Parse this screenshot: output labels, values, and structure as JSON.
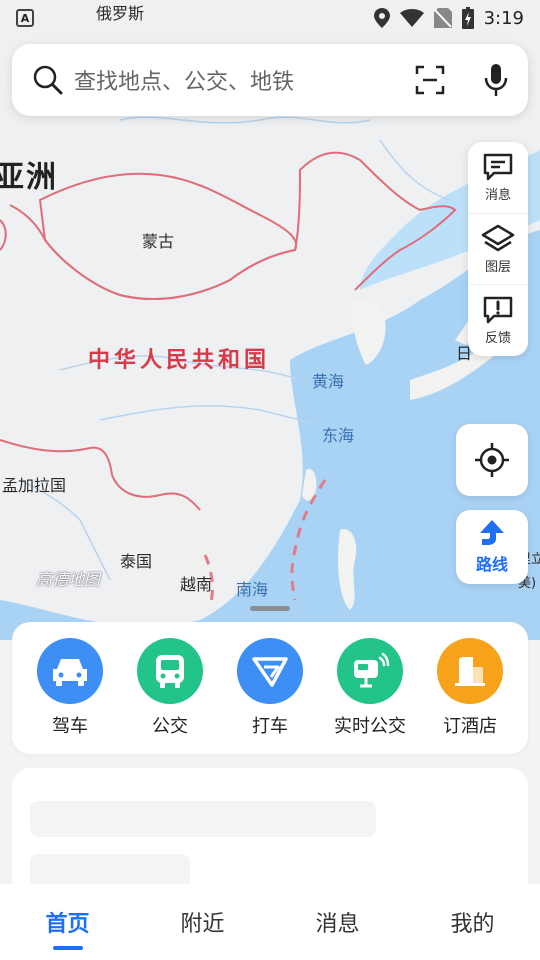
{
  "status_bar": {
    "notification_letter": "A",
    "time": "3:19"
  },
  "search": {
    "placeholder": "查找地点、公交、地铁"
  },
  "map": {
    "labels": {
      "russia": "俄罗斯",
      "asia": "亚洲",
      "mongolia": "蒙古",
      "china": "中华人民共和国",
      "yellow_sea": "黄海",
      "east_sea": "东海",
      "bangladesh": "孟加拉国",
      "thailand": "泰国",
      "vietnam": "越南",
      "south_sea": "南海",
      "japan_partial": "日",
      "right_edge_1": "里立",
      "right_edge_2": "美)"
    },
    "watermark": "高德地图"
  },
  "tools": [
    {
      "icon": "message-icon",
      "label": "消息"
    },
    {
      "icon": "layers-icon",
      "label": "图层"
    },
    {
      "icon": "feedback-icon",
      "label": "反馈"
    }
  ],
  "route": {
    "label": "路线"
  },
  "quick_actions": [
    {
      "label": "驾车",
      "icon": "car-icon",
      "color": "#3d8ff5"
    },
    {
      "label": "公交",
      "icon": "bus-icon",
      "color": "#22c48a"
    },
    {
      "label": "打车",
      "icon": "taxi-icon",
      "color": "#3d8ff5"
    },
    {
      "label": "实时公交",
      "icon": "realtime-bus-icon",
      "color": "#22c48a"
    },
    {
      "label": "订酒店",
      "icon": "hotel-icon",
      "color": "#f7a21b"
    }
  ],
  "bottom_nav": [
    {
      "label": "首页",
      "active": true
    },
    {
      "label": "附近",
      "active": false
    },
    {
      "label": "消息",
      "active": false
    },
    {
      "label": "我的",
      "active": false
    }
  ]
}
